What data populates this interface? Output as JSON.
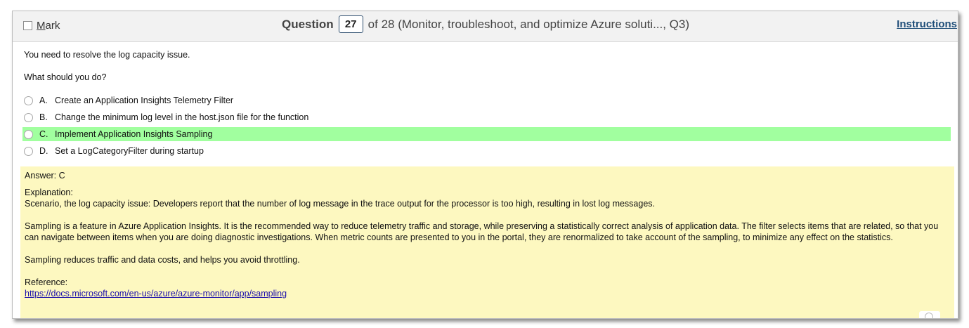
{
  "header": {
    "mark_label_first": "M",
    "mark_label_rest": "ark",
    "question_word": "Question",
    "question_number": "27",
    "question_of": "of 28 (Monitor, troubleshoot, and optimize Azure soluti..., Q3)",
    "instructions_label": "Instructions"
  },
  "question": {
    "stem_1": "You need to resolve the log capacity issue.",
    "stem_2": "What should you do?",
    "options": [
      {
        "letter": "A.",
        "text": "Create an Application Insights Telemetry Filter"
      },
      {
        "letter": "B.",
        "text": "Change the minimum log level in the host.json file for the function"
      },
      {
        "letter": "C.",
        "text": "Implement Application Insights Sampling"
      },
      {
        "letter": "D.",
        "text": "Set a LogCategoryFilter during startup"
      }
    ]
  },
  "answer": {
    "answer_line": "Answer: C",
    "explanation_label": "Explanation:",
    "scenario": "Scenario, the log capacity issue: Developers report that the number of log message in the trace output for the processor is too high, resulting in lost log messages.",
    "sampling_paragraph": "Sampling is a feature in Azure Application Insights. It is the recommended way to reduce telemetry traffic and storage, while preserving a statistically correct analysis of application data. The filter selects items that are related, so that you can navigate between items when you are doing diagnostic investigations. When metric counts are presented to you in the portal, they are renormalized to take account of the sampling, to minimize any effect on the statistics.",
    "sampling_reduces": "Sampling reduces traffic and data costs, and helps you avoid throttling.",
    "reference_label": "Reference:",
    "reference_url": "https://docs.microsoft.com/en-us/azure/azure-monitor/app/sampling"
  },
  "colors": {
    "correct_highlight": "#a1ff9f",
    "answer_background": "#fdf8c0",
    "instructions_link": "#1f4e79"
  }
}
